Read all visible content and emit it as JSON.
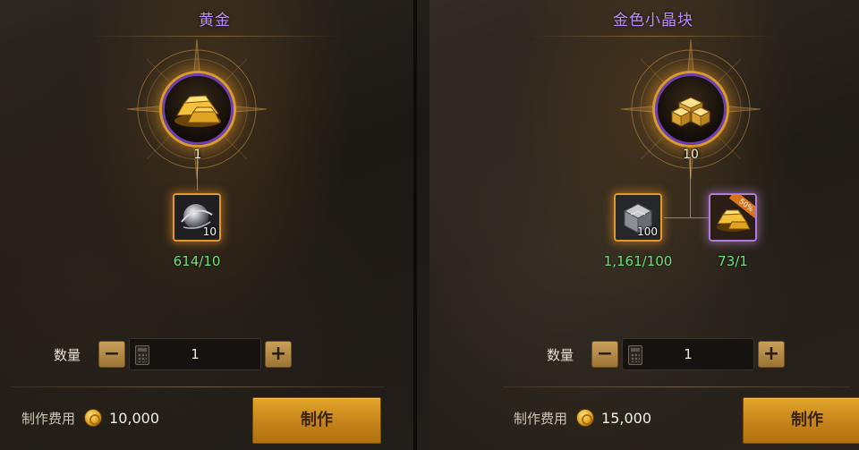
{
  "panels": [
    {
      "title": "黄金",
      "result": {
        "icon": "gold-ingot-icon",
        "quantity": "1"
      },
      "materials": [
        {
          "icon": "silver-orb-icon",
          "badge": "10",
          "count": "614/10"
        }
      ],
      "quantity": {
        "label": "数量",
        "value": "1",
        "minus": "−",
        "plus": "+"
      },
      "cost": {
        "label": "制作费用",
        "icon": "gold-coin-icon",
        "value": "10,000"
      },
      "craft_button": "制作"
    },
    {
      "title": "金色小晶块",
      "result": {
        "icon": "gold-crystal-cubes-icon",
        "quantity": "10"
      },
      "materials": [
        {
          "icon": "silver-crystal-icon",
          "badge": "100",
          "count": "1,161/100"
        },
        {
          "icon": "gold-ingot-icon",
          "badge": "",
          "count": "73/1",
          "ribbon": "50%"
        }
      ],
      "quantity": {
        "label": "数量",
        "value": "1",
        "minus": "−",
        "plus": "+"
      },
      "cost": {
        "label": "制作费用",
        "icon": "gold-coin-icon",
        "value": "15,000"
      },
      "craft_button": "制作"
    }
  ],
  "colors": {
    "title": "#b98bff",
    "material_count": "#6fe07a",
    "craft_button": "#d99a24",
    "frame_orange": "#e0992a",
    "frame_purple": "#6b3fb0"
  }
}
